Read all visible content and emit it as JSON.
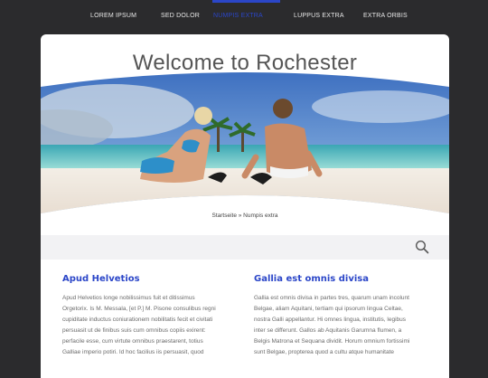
{
  "nav": {
    "items": [
      {
        "label": "LOREM IPSUM"
      },
      {
        "label": "SED DOLOR"
      },
      {
        "label": "NUMPIS EXTRA"
      },
      {
        "label": "LUPPUS EXTRA"
      },
      {
        "label": "EXTRA ORBIS"
      }
    ],
    "active_color": "#2b46c8"
  },
  "page": {
    "title": "Welcome to Rochester",
    "breadcrumb": "Startseite » Numpis extra"
  },
  "search": {
    "icon": "search-icon"
  },
  "columns": [
    {
      "heading": "Apud Helvetios",
      "text": "Apud Helvetios longe nobilissimus fuit et ditissimus Orgetorix. Is M. Messala, [et P.] M. Pisone consulibus regni cupiditate inductus coniurationem nobilitatis fecit et civitati persuasit ut de finibus suis cum omnibus copiis exirent: perfacile esse, cum virtute omnibus praestarent, totius Galliae imperio potiri. Id hoc facilius iis persuasit, quod"
    },
    {
      "heading": "Gallia est omnis divisa",
      "text": "Gallia est omnis divisa in partes tres, quarum unam incolunt Belgae, aliam Aquitani, tertiam qui ipsorum lingua Celtae, nostra Galli appellantur. Hi omnes lingua, institutis, legibus inter se differunt. Gallos ab Aquitanis Garumna flumen, a Belgis Matrona et Sequana dividit. Horum omnium fortissimi sunt Belgae, propterea quod a cultu atque humanitate"
    }
  ]
}
